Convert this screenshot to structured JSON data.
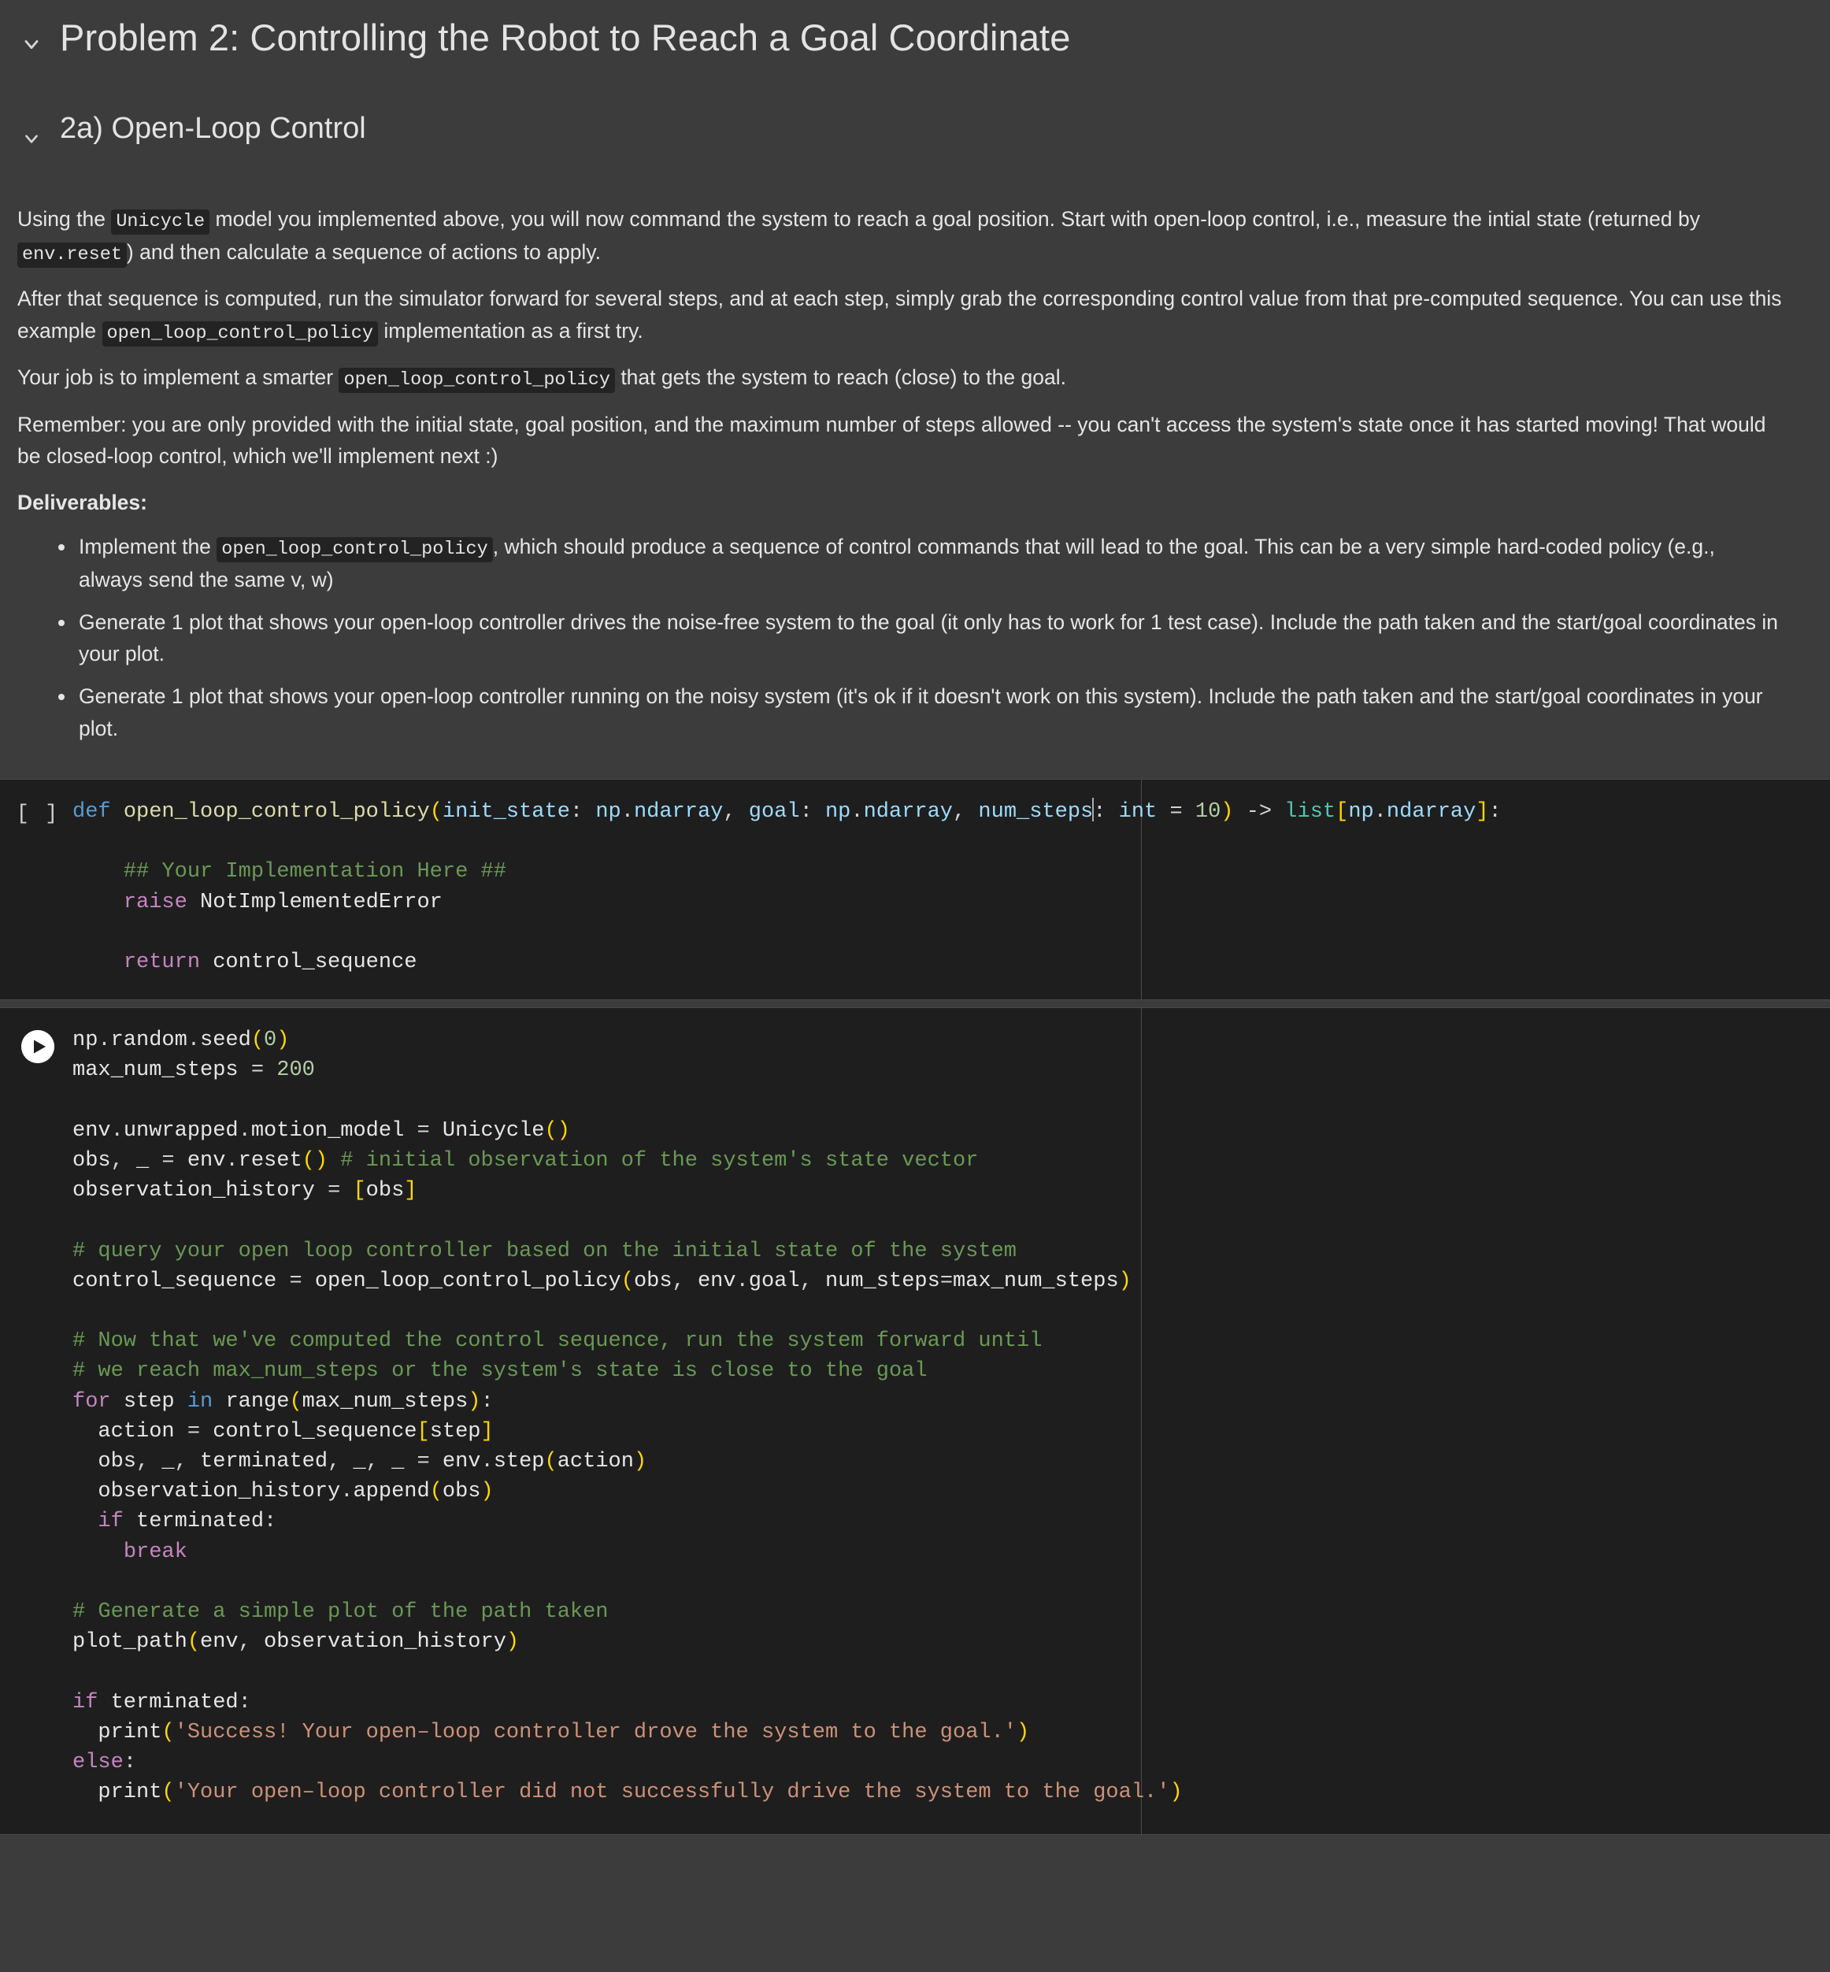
{
  "notebook": {
    "sections": [
      {
        "id": "problem2",
        "title": "Problem 2: Controlling the Robot to Reach a Goal Coordinate",
        "chevron_icon": "chevron-down-icon"
      },
      {
        "id": "part2a",
        "title": "2a) Open-Loop Control",
        "chevron_icon": "chevron-down-icon"
      }
    ]
  },
  "prose": {
    "p1_a": "Using the ",
    "p1_code1": "Unicycle",
    "p1_b": " model you implemented above, you will now command the system to reach a goal position. Start with open-loop control, i.e., measure the intial state (returned by ",
    "p1_code2": "env.reset",
    "p1_c": ") and then calculate a sequence of actions to apply.",
    "p2_a": "After that sequence is computed, run the simulator forward for several steps, and at each step, simply grab the corresponding control value from that pre-computed sequence. You can use this example ",
    "p2_code1": "open_loop_control_policy",
    "p2_b": " implementation as a first try.",
    "p3_a": "Your job is to implement a smarter ",
    "p3_code1": "open_loop_control_policy",
    "p3_b": " that gets the system to reach (close) to the goal.",
    "p4": "Remember: you are only provided with the initial state, goal position, and the maximum number of steps allowed -- you can't access the system's state once it has started moving! That would be closed-loop control, which we'll implement next :)",
    "deliverables_label": "Deliverables",
    "deliverables_colon": ":",
    "bullets": [
      {
        "a": "Implement the ",
        "code": "open_loop_control_policy",
        "b": ", which should produce a sequence of control commands that will lead to the goal. This can be a very simple hard-coded policy (e.g., always send the same v, w)"
      },
      {
        "a": "Generate 1 plot that shows your open-loop controller drives the noise-free system to the goal (it only has to work for 1 test case). Include the path taken and the start/goal coordinates in your plot.",
        "code": "",
        "b": ""
      },
      {
        "a": "Generate 1 plot that shows your open-loop controller running on the noisy system (it's ok if it doesn't work on this system). Include the path taken and the start/goal coordinates in your plot.",
        "code": "",
        "b": ""
      }
    ]
  },
  "cells": [
    {
      "id": "cell-open-loop-policy",
      "prompt": "[ ]",
      "execution_state": "not-run",
      "run_icon": "empty-brackets-icon",
      "lines": [
        "def open_loop_control_policy(init_state: np.ndarray, goal: np.ndarray, num_steps: int = 10) -> list[np.ndarray]:",
        "",
        "    ## Your Implementation Here ##",
        "    raise NotImplementedError",
        "",
        "    return control_sequence"
      ]
    },
    {
      "id": "cell-open-loop-run",
      "prompt": "",
      "execution_state": "runnable",
      "run_icon": "play-icon",
      "lines": [
        "np.random.seed(0)",
        "max_num_steps = 200",
        "",
        "env.unwrapped.motion_model = Unicycle()",
        "obs, _ = env.reset() # initial observation of the system's state vector",
        "observation_history = [obs]",
        "",
        "# query your open loop controller based on the initial state of the system",
        "control_sequence = open_loop_control_policy(obs, env.goal, num_steps=max_num_steps)",
        "",
        "# Now that we've computed the control sequence, run the system forward until",
        "# we reach max_num_steps or the system's state is close to the goal",
        "for step in range(max_num_steps):",
        "  action = control_sequence[step]",
        "  obs, _, terminated, _, _ = env.step(action)",
        "  observation_history.append(obs)",
        "  if terminated:",
        "    break",
        "",
        "# Generate a simple plot of the path taken",
        "plot_path(env, observation_history)",
        "",
        "if terminated:",
        "  print('Success! Your open-loop controller drove the system to the goal.')",
        "else:",
        "  print('Your open-loop controller did not successfully drive the system to the goal.')"
      ]
    }
  ],
  "colors": {
    "page_background": "#3c3c3c",
    "code_background": "#1e1e1e",
    "text": "#e6e6e6",
    "keyword_blue": "#569cd6",
    "keyword_magenta": "#c586c0",
    "function_yellow": "#dcdcaa",
    "variable_blue": "#9cdcfe",
    "number_green": "#b5cea8",
    "class_teal": "#4ec9b0",
    "comment_green": "#6a9955",
    "string_salmon": "#ce9178",
    "bracket_gold": "#ffd700"
  }
}
